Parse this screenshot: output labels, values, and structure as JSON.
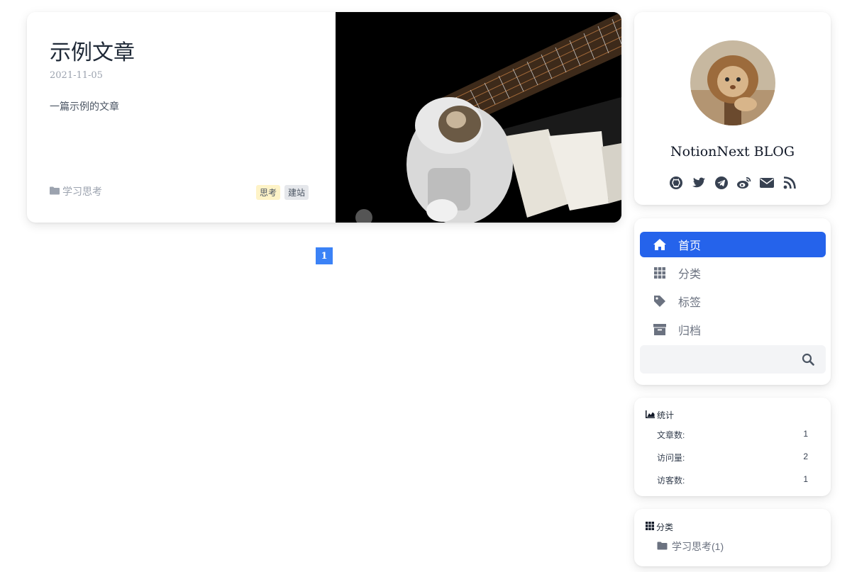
{
  "post": {
    "title": "示例文章",
    "date": "2021-11-05",
    "summary": "一篇示例的文章",
    "category": "学习思考",
    "tags": [
      {
        "label": "思考",
        "bg": "#fef3c7"
      },
      {
        "label": "建站",
        "bg": "#e5e7eb"
      }
    ]
  },
  "pagination": {
    "current": "1"
  },
  "profile": {
    "name": "NotionNext BLOG",
    "socials": [
      "github-icon",
      "twitter-icon",
      "telegram-icon",
      "weibo-icon",
      "mail-icon",
      "rss-icon"
    ]
  },
  "menu": {
    "items": [
      {
        "label": "首页",
        "icon": "home-icon",
        "active": true
      },
      {
        "label": "分类",
        "icon": "grid-icon",
        "active": false
      },
      {
        "label": "标签",
        "icon": "tag-icon",
        "active": false
      },
      {
        "label": "归档",
        "icon": "archive-icon",
        "active": false
      }
    ],
    "search_placeholder": ""
  },
  "stats": {
    "heading": "统计",
    "rows": [
      {
        "label": "文章数:",
        "value": "1"
      },
      {
        "label": "访问量:",
        "value": "2"
      },
      {
        "label": "访客数:",
        "value": "1"
      }
    ]
  },
  "categories": {
    "heading": "分类",
    "items": [
      {
        "label": "学习思考(1)"
      }
    ]
  },
  "colors": {
    "accent": "#2563eb",
    "pagination": "#3b82f6"
  }
}
